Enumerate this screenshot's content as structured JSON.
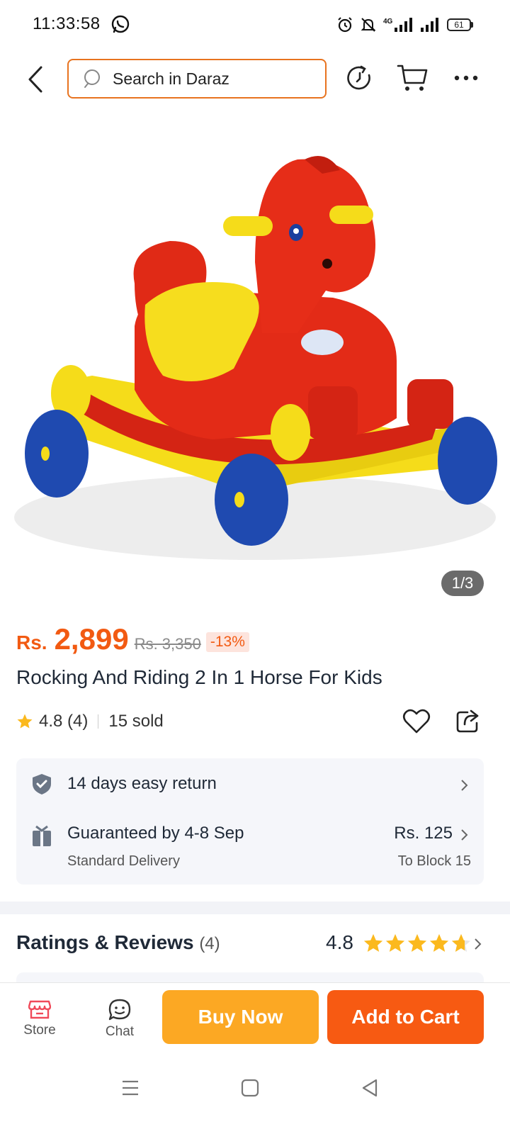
{
  "status_bar": {
    "time": "11:33:58",
    "network": "4G",
    "battery": "61"
  },
  "search": {
    "placeholder": "Search in Daraz"
  },
  "gallery": {
    "counter": "1/3"
  },
  "product": {
    "currency": "Rs.",
    "price": "2,899",
    "original_price": "Rs. 3,350",
    "discount": "-13%",
    "title": "Rocking And Riding 2 In 1 Horse For Kids",
    "rating": "4.8",
    "rating_count": "(4)",
    "sold": "15 sold"
  },
  "delivery": {
    "return_text": "14 days easy return",
    "guarantee_text": "Guaranteed by 4-8 Sep",
    "method": "Standard Delivery",
    "fee": "Rs. 125",
    "destination": "To Block 15"
  },
  "reviews": {
    "title": "Ratings & Reviews",
    "count": "(4)",
    "score": "4.8",
    "stars": 4.8
  },
  "bottom_bar": {
    "store_label": "Store",
    "chat_label": "Chat",
    "buy_now_label": "Buy Now",
    "add_to_cart_label": "Add to Cart"
  },
  "colors": {
    "accent": "#f25a12",
    "buy_now": "#fca823",
    "add_to_cart": "#f75a12",
    "star": "#fbb91e"
  }
}
